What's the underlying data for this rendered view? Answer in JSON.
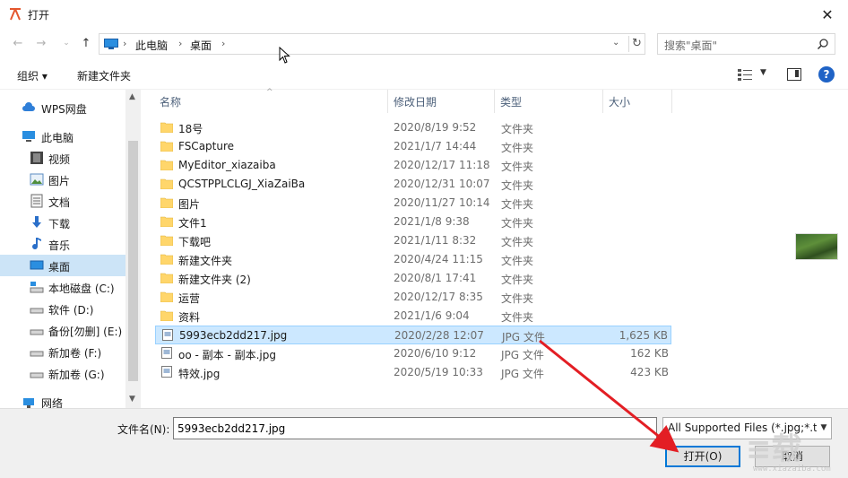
{
  "window": {
    "title": "打开"
  },
  "address": {
    "segments": [
      "此电脑",
      "桌面"
    ]
  },
  "search": {
    "placeholder": "搜索\"桌面\""
  },
  "toolbar": {
    "organize": "组织 ▾",
    "new_folder": "新建文件夹"
  },
  "sidebar": {
    "items": [
      {
        "label": "WPS网盘",
        "icon": "cloud-icon"
      },
      {
        "label": "此电脑",
        "icon": "computer-icon"
      },
      {
        "label": "视频",
        "icon": "video-icon"
      },
      {
        "label": "图片",
        "icon": "picture-icon"
      },
      {
        "label": "文档",
        "icon": "document-icon"
      },
      {
        "label": "下载",
        "icon": "download-icon"
      },
      {
        "label": "音乐",
        "icon": "music-icon"
      },
      {
        "label": "桌面",
        "icon": "desktop-icon",
        "selected": true
      },
      {
        "label": "本地磁盘 (C:)",
        "icon": "drive-icon"
      },
      {
        "label": "软件 (D:)",
        "icon": "drive-icon"
      },
      {
        "label": "备份[勿删] (E:)",
        "icon": "drive-icon"
      },
      {
        "label": "新加卷 (F:)",
        "icon": "drive-icon"
      },
      {
        "label": "新加卷 (G:)",
        "icon": "drive-icon"
      },
      {
        "label": "网络",
        "icon": "network-icon"
      }
    ]
  },
  "columns": {
    "name": "名称",
    "date": "修改日期",
    "type": "类型",
    "size": "大小"
  },
  "files": [
    {
      "name": "18号",
      "date": "2020/8/19 9:52",
      "type": "文件夹",
      "size": "",
      "kind": "folder"
    },
    {
      "name": "FSCapture",
      "date": "2021/1/7 14:44",
      "type": "文件夹",
      "size": "",
      "kind": "folder"
    },
    {
      "name": "MyEditor_xiazaiba",
      "date": "2020/12/17 11:18",
      "type": "文件夹",
      "size": "",
      "kind": "folder"
    },
    {
      "name": "QCSTPPLCLGJ_XiaZaiBa",
      "date": "2020/12/31 10:07",
      "type": "文件夹",
      "size": "",
      "kind": "folder"
    },
    {
      "name": "图片",
      "date": "2020/11/27 10:14",
      "type": "文件夹",
      "size": "",
      "kind": "folder"
    },
    {
      "name": "文件1",
      "date": "2021/1/8 9:38",
      "type": "文件夹",
      "size": "",
      "kind": "folder"
    },
    {
      "name": "下载吧",
      "date": "2021/1/11 8:32",
      "type": "文件夹",
      "size": "",
      "kind": "folder"
    },
    {
      "name": "新建文件夹",
      "date": "2020/4/24 11:15",
      "type": "文件夹",
      "size": "",
      "kind": "folder"
    },
    {
      "name": "新建文件夹 (2)",
      "date": "2020/8/1 17:41",
      "type": "文件夹",
      "size": "",
      "kind": "folder"
    },
    {
      "name": "运营",
      "date": "2020/12/17 8:35",
      "type": "文件夹",
      "size": "",
      "kind": "folder"
    },
    {
      "name": "资料",
      "date": "2021/1/6 9:04",
      "type": "文件夹",
      "size": "",
      "kind": "folder"
    },
    {
      "name": "5993ecb2dd217.jpg",
      "date": "2020/2/28 12:07",
      "type": "JPG 文件",
      "size": "1,625 KB",
      "kind": "jpg",
      "selected": true
    },
    {
      "name": "oo - 副本 - 副本.jpg",
      "date": "2020/6/10 9:12",
      "type": "JPG 文件",
      "size": "162 KB",
      "kind": "jpg"
    },
    {
      "name": "特效.jpg",
      "date": "2020/5/19 10:33",
      "type": "JPG 文件",
      "size": "423 KB",
      "kind": "jpg"
    }
  ],
  "bottom": {
    "filename_label": "文件名(N):",
    "filename_value": "5993ecb2dd217.jpg",
    "filter": "All Supported Files (*.jpg;*.tif",
    "open": "打开(O)",
    "cancel": "取消"
  },
  "watermark": {
    "text": "www.xiazaiba.com"
  },
  "colors": {
    "accent": "#0078d7",
    "selection": "#cce8ff",
    "folder": "#ffd66b",
    "annotation": "#e31e24"
  }
}
